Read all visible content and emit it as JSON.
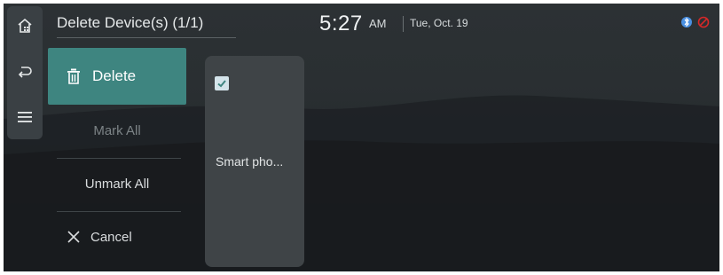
{
  "header": {
    "title": "Delete Device(s) (1/1)",
    "time": "5:27",
    "ampm": "AM",
    "date": "Tue, Oct. 19"
  },
  "left_bar": {
    "icons": [
      "home-icon",
      "back-icon",
      "menu-icon"
    ]
  },
  "menu": {
    "delete_label": "Delete",
    "mark_all_label": "Mark All",
    "unmark_all_label": "Unmark All",
    "cancel_label": "Cancel"
  },
  "devices": [
    {
      "name": "Smart pho...",
      "checked": true
    }
  ],
  "status_icons": [
    "bluetooth-icon",
    "no-phone-icon"
  ],
  "colors": {
    "accent": "#3e8580",
    "checkbox": "#d4e4ea",
    "status_red": "#d62828",
    "status_blue": "#4a90e2"
  }
}
